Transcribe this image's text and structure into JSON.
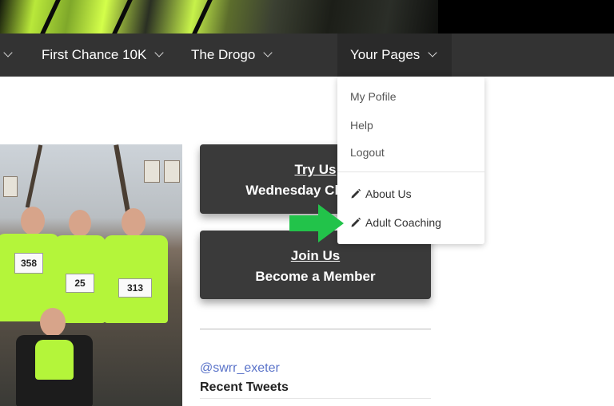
{
  "nav": {
    "items": [
      {
        "label": "First Chance 10K"
      },
      {
        "label": "The Drogo"
      },
      {
        "label": "Your Pages"
      }
    ]
  },
  "dropdown": {
    "items": [
      {
        "label": "My Pofile"
      },
      {
        "label": "Help"
      },
      {
        "label": "Logout"
      },
      {
        "label": "About Us",
        "icon": "pencil-icon"
      },
      {
        "label": "Adult Coaching",
        "icon": "pencil-icon"
      }
    ]
  },
  "photo": {
    "bibs": [
      "358",
      "25",
      "313"
    ]
  },
  "cta": {
    "try": {
      "line1": "Try Us",
      "line2": "Wednesday Club Run"
    },
    "join": {
      "line1": "Join Us",
      "line2": "Become a Member"
    }
  },
  "twitter": {
    "handle": "@swrr_exeter",
    "heading": "Recent Tweets"
  },
  "colors": {
    "nav_bg": "#333333",
    "button_bg": "#3a3a3a",
    "link": "#5a73c9",
    "arrow": "#22c34a"
  }
}
